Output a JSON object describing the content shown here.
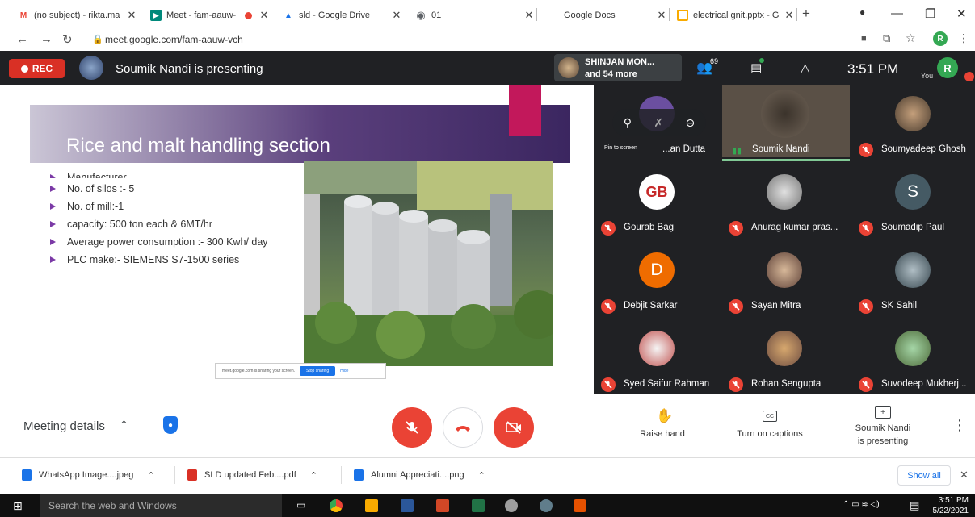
{
  "browser": {
    "tabs": [
      {
        "label": "(no subject) - rikta.ma",
        "favicon_color": "#ea4335",
        "favicon_glyph": "M"
      },
      {
        "label": "Meet - fam-aauw-",
        "favicon_color": "#00897b",
        "favicon_glyph": "▶"
      },
      {
        "label": "sld - Google Drive",
        "favicon_color": "#1a73e8",
        "favicon_glyph": "▲"
      },
      {
        "label": "01",
        "favicon_color": "#5f6368",
        "favicon_glyph": "◉"
      },
      {
        "label": "Google Docs",
        "favicon_color": "#ffffff",
        "favicon_glyph": ""
      },
      {
        "label": "electrical gnit.pptx - G",
        "favicon_color": "#f9ab00",
        "favicon_glyph": "▭"
      }
    ],
    "new_tab": "+",
    "url": "meet.google.com/fam-aauw-vch",
    "profile_initial": "R"
  },
  "meet": {
    "rec_label": "REC",
    "presenter_banner": "Soumik Nandi is presenting",
    "participants_summary_line1": "SHINJAN MON...",
    "participants_summary_line2": "and 54 more",
    "participant_count": "69",
    "clock": "3:51 PM",
    "self_label": "You",
    "self_initial": "R",
    "pin_tooltip": "Pin to screen"
  },
  "slide": {
    "title": "Rice and malt handling section",
    "bullets": [
      "Manufacturer",
      "No. of silos :- 5",
      "No. of mill:-1",
      "capacity: 500 ton each & 6MT/hr",
      "Average power consumption :- 300 Kwh/ day",
      "PLC make:- SIEMENS S7-1500 series"
    ]
  },
  "share_bar": {
    "message": "meet.google.com is sharing your screen.",
    "stop_label": "Stop sharing",
    "hide_label": "Hide"
  },
  "tiles": [
    {
      "name": "...an Dutta",
      "avatar": "",
      "color": "#6b4fa0",
      "muted": true
    },
    {
      "name": "Soumik Nandi",
      "avatar": "",
      "color": "#5a5046",
      "muted": false,
      "speaking": true
    },
    {
      "name": "Soumyadeep Ghosh",
      "avatar": "",
      "color": "#7b6a5a",
      "muted": true
    },
    {
      "name": "Gourab Bag",
      "avatar": "GB",
      "color": "#ffffff",
      "muted": true
    },
    {
      "name": "Anurag kumar pras...",
      "avatar": "",
      "color": "#9e9e9e",
      "muted": true
    },
    {
      "name": "Soumadip Paul",
      "avatar": "S",
      "color": "#455a64",
      "muted": true
    },
    {
      "name": "Debjit Sarkar",
      "avatar": "D",
      "color": "#ef6c00",
      "muted": true
    },
    {
      "name": "Sayan Mitra",
      "avatar": "",
      "color": "#8d6e63",
      "muted": true
    },
    {
      "name": "SK Sahil",
      "avatar": "",
      "color": "#607d8b",
      "muted": true
    },
    {
      "name": "Syed Saifur Rahman",
      "avatar": "",
      "color": "#c0504d",
      "muted": true
    },
    {
      "name": "Rohan Sengupta",
      "avatar": "",
      "color": "#a1887f",
      "muted": true
    },
    {
      "name": "Suvodeep Mukherj...",
      "avatar": "",
      "color": "#6d8b5a",
      "muted": true
    }
  ],
  "controls": {
    "meeting_details": "Meeting details",
    "raise_hand": "Raise hand",
    "captions": "Turn on captions",
    "presenting_line1": "Soumik Nandi",
    "presenting_line2": "is presenting"
  },
  "downloads": {
    "items": [
      {
        "label": "WhatsApp Image....jpeg",
        "color": "#1a73e8"
      },
      {
        "label": "SLD updated Feb....pdf",
        "color": "#d93025"
      },
      {
        "label": "Alumni Appreciati....png",
        "color": "#1a73e8"
      }
    ],
    "show_all": "Show all"
  },
  "taskbar": {
    "search_placeholder": "Search the web and Windows",
    "time": "3:51 PM",
    "date": "5/22/2021"
  },
  "colors": {
    "meet_bg": "#202124",
    "danger": "#ea4335",
    "accent": "#1a73e8"
  }
}
